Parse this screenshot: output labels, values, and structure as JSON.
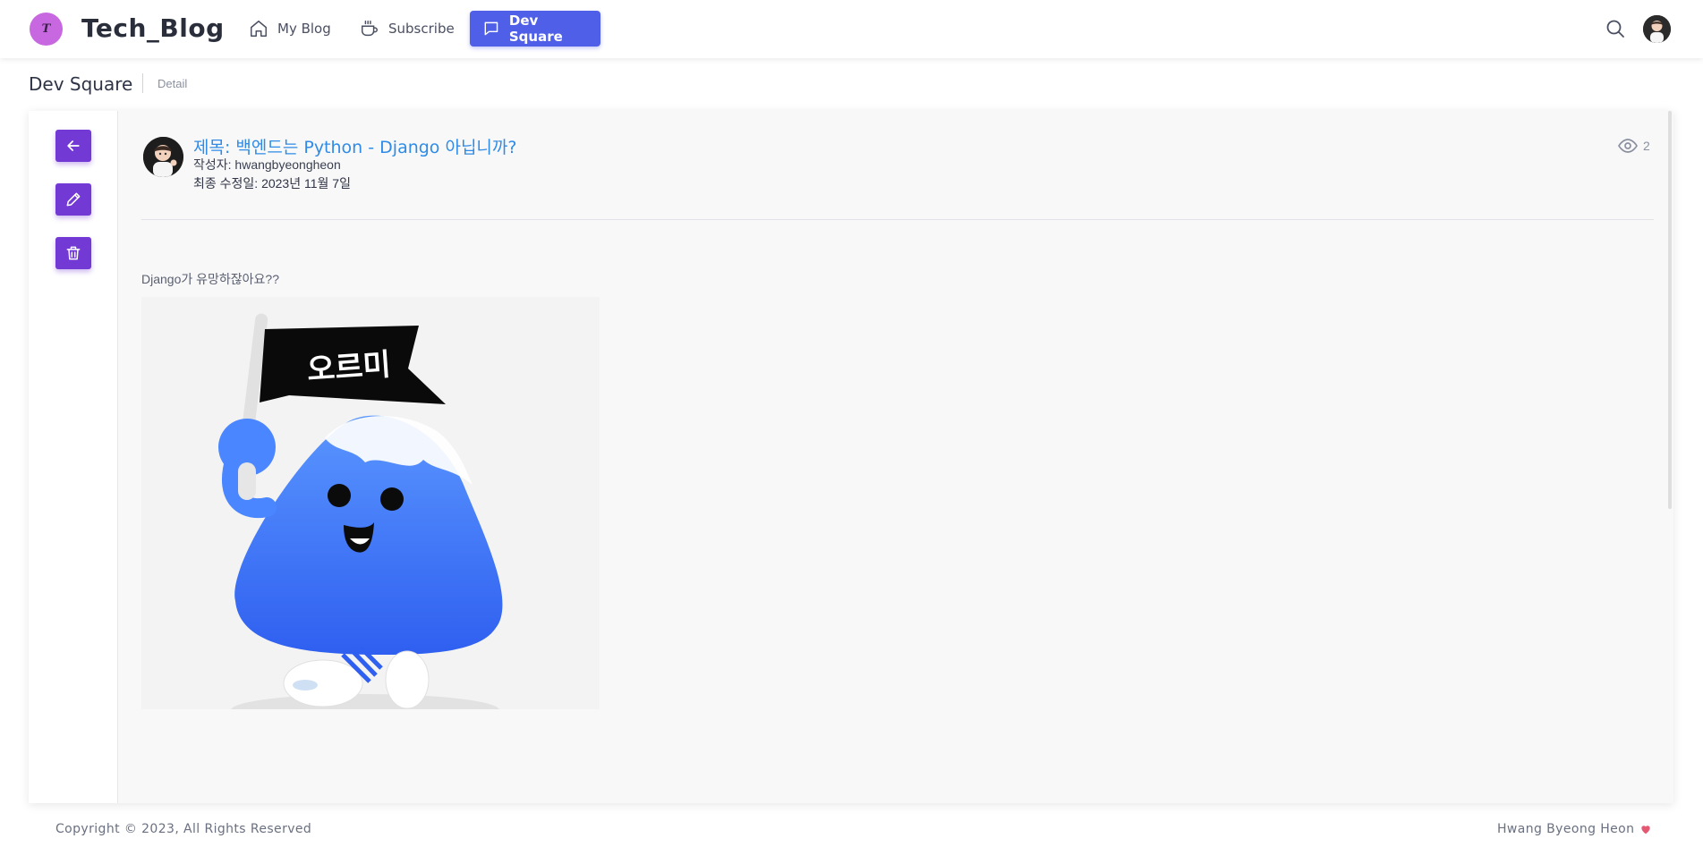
{
  "brand": {
    "logo_letter": "T",
    "name": "Tech_Blog"
  },
  "nav": {
    "items": [
      {
        "label": "My Blog",
        "icon": "home-icon"
      },
      {
        "label": "Subscribe",
        "icon": "coffee-cup-icon"
      },
      {
        "label": "Dev Square",
        "icon": "chat-bubble-icon",
        "active": true
      }
    ]
  },
  "header_actions": {
    "search_icon": "search-icon",
    "avatar": "user-avatar"
  },
  "breadcrumb": {
    "title": "Dev Square",
    "sub": "Detail"
  },
  "actions": {
    "back": "arrow-left-icon",
    "edit": "pencil-icon",
    "delete": "trash-icon"
  },
  "post": {
    "title": "제목: 백엔드는 Python - Django 아닙니까?",
    "author": "작성자: hwangbyeongheon",
    "updated": "최종 수정일: 2023년 11월 7일",
    "views": "2",
    "body": "Django가 유망하잖아요??",
    "image_flag_text": "오르미"
  },
  "footer": {
    "copyright": "Copyright © 2023, All Rights Reserved",
    "author": "Hwang Byeong Heon"
  },
  "colors": {
    "primary": "#4f5fe8",
    "action": "#7239d4",
    "title": "#2f8be6",
    "logo": "#c868e0",
    "heart": "#e55873"
  }
}
